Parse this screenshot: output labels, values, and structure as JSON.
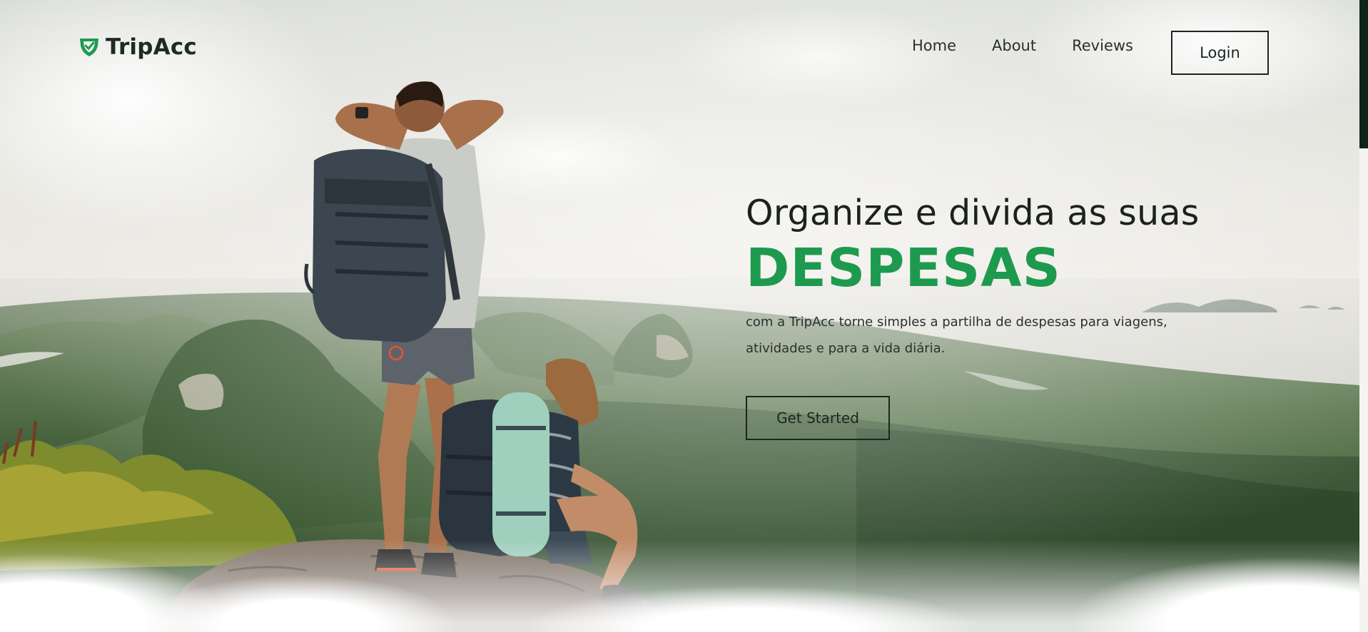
{
  "brand": {
    "name": "TripAcc",
    "accent_color": "#1e9a4f",
    "icon": "shield-check-icon"
  },
  "nav": {
    "links": [
      {
        "label": "Home"
      },
      {
        "label": "About"
      },
      {
        "label": "Reviews"
      }
    ],
    "login_label": "Login"
  },
  "hero": {
    "headline": "Organize e divida as suas",
    "highlight": "DESPESAS",
    "description": "com a TripAcc torne simples a partilha de despesas para viagens, atividades e para a vida diária.",
    "cta_label": "Get Started"
  },
  "background": {
    "image": "hikers-on-mountain-cliff-photo"
  }
}
